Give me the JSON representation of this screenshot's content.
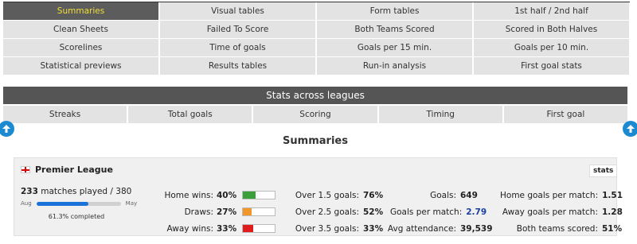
{
  "nav": {
    "items": [
      {
        "label": "Summaries",
        "active": true
      },
      {
        "label": "Visual tables"
      },
      {
        "label": "Form tables"
      },
      {
        "label": "1st half / 2nd half"
      },
      {
        "label": "Clean Sheets"
      },
      {
        "label": "Failed To Score"
      },
      {
        "label": "Both Teams Scored"
      },
      {
        "label": "Scored in Both Halves"
      },
      {
        "label": "Scorelines"
      },
      {
        "label": "Time of goals"
      },
      {
        "label": "Goals per 15 min."
      },
      {
        "label": "Goals per 10 min."
      },
      {
        "label": "Statistical previews"
      },
      {
        "label": "Results tables"
      },
      {
        "label": "Run-in analysis"
      },
      {
        "label": "First goal stats"
      }
    ]
  },
  "stats_across": {
    "title": "Stats across leagues",
    "tabs": [
      "Streaks",
      "Total goals",
      "Scoring",
      "Timing",
      "First goal"
    ]
  },
  "page_heading": "Summaries",
  "league": {
    "name": "Premier League",
    "badge": "stats",
    "matches_played": "233",
    "matches_text": " matches played / 380",
    "progress_start": "Aug",
    "progress_end": "May",
    "progress_fraction": 0.613,
    "completed_text": "61.3% completed",
    "results": [
      {
        "label": "Home wins:",
        "value": "40%",
        "fraction": 0.4,
        "color": "#3aa13a"
      },
      {
        "label": "Draws:",
        "value": "27%",
        "fraction": 0.27,
        "color": "#f0962a"
      },
      {
        "label": "Away wins:",
        "value": "33%",
        "fraction": 0.33,
        "color": "#e01b1b"
      }
    ],
    "overs": [
      {
        "label": "Over 1.5 goals:",
        "value": "76%"
      },
      {
        "label": "Over 2.5 goals:",
        "value": "52%"
      },
      {
        "label": "Over 3.5 goals:",
        "value": "33%"
      }
    ],
    "goals": [
      {
        "label": "Goals:",
        "value": "649"
      },
      {
        "label": "Goals per match:",
        "value": "2.79"
      },
      {
        "label": "Avg attendance:",
        "value": "39,539"
      }
    ],
    "home_away": [
      {
        "label": "Home goals per match:",
        "value": "1.51"
      },
      {
        "label": "Away goals per match:",
        "value": "1.28"
      },
      {
        "label": "Both teams scored:",
        "value": "51%"
      }
    ]
  },
  "icons": {
    "left_arrow": "arrow-up-circle-icon",
    "right_arrow": "arrow-up-circle-icon",
    "flag": "england-flag-icon"
  }
}
